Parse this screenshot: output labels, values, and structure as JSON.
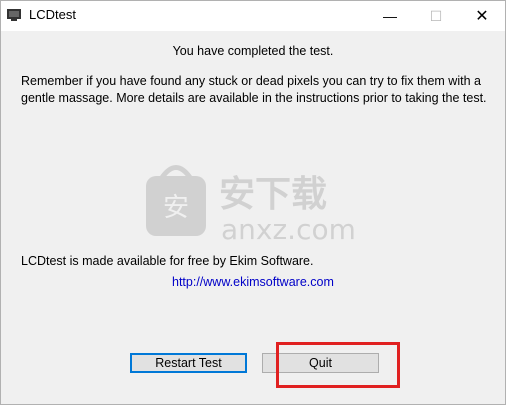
{
  "window": {
    "title": "LCDtest",
    "controls": {
      "minimize": "—",
      "maximize": "☐",
      "close": "✕"
    }
  },
  "content": {
    "completed": "You have completed the test.",
    "remember": "Remember if you have found any stuck or dead pixels you can try to fix them with a gentle massage.  More details are available in the instructions prior to taking the test.",
    "free": "LCDtest is made available for free by Ekim Software.",
    "link": "http://www.ekimsoftware.com"
  },
  "buttons": {
    "restart": "Restart Test",
    "quit": "Quit"
  },
  "watermark": {
    "chinese": "安下载",
    "domain": "anxz.com",
    "badge": "安"
  },
  "colors": {
    "link": "#0000c8",
    "highlight": "#e02020",
    "focus": "#0078d7"
  }
}
